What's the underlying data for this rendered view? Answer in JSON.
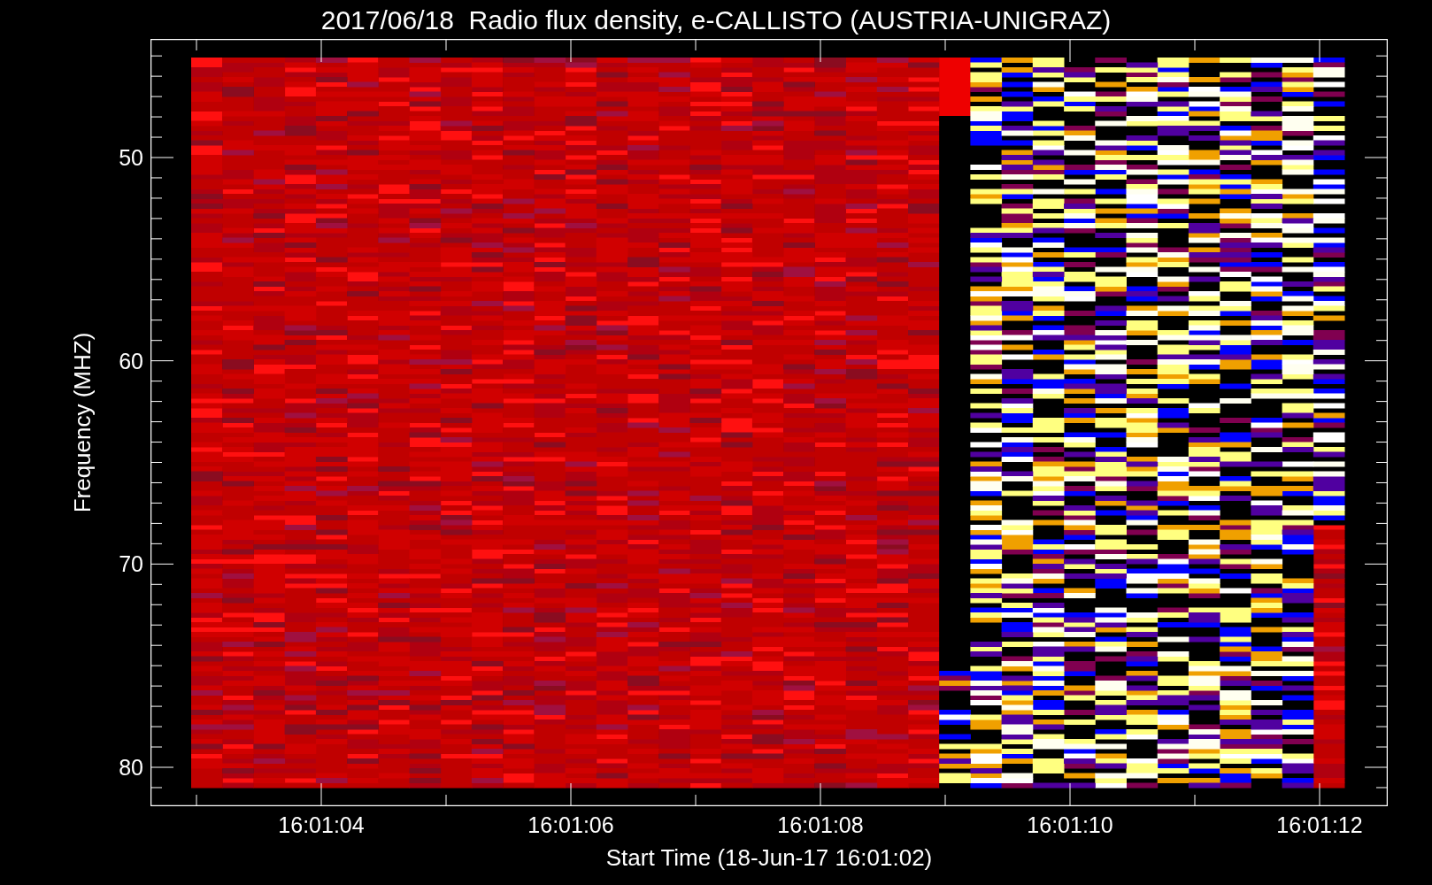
{
  "title": "2017/06/18  Radio flux density, e-CALLISTO (AUSTRIA-UNIGRAZ)",
  "y_axis": {
    "label": "Frequency (MHZ)",
    "ticks": [
      "50",
      "60",
      "70",
      "80"
    ]
  },
  "x_axis": {
    "label": "Start Time (18-Jun-17 16:01:02)",
    "ticks": [
      "16:01:04",
      "16:01:06",
      "16:01:08",
      "16:01:10",
      "16:01:12"
    ]
  }
}
